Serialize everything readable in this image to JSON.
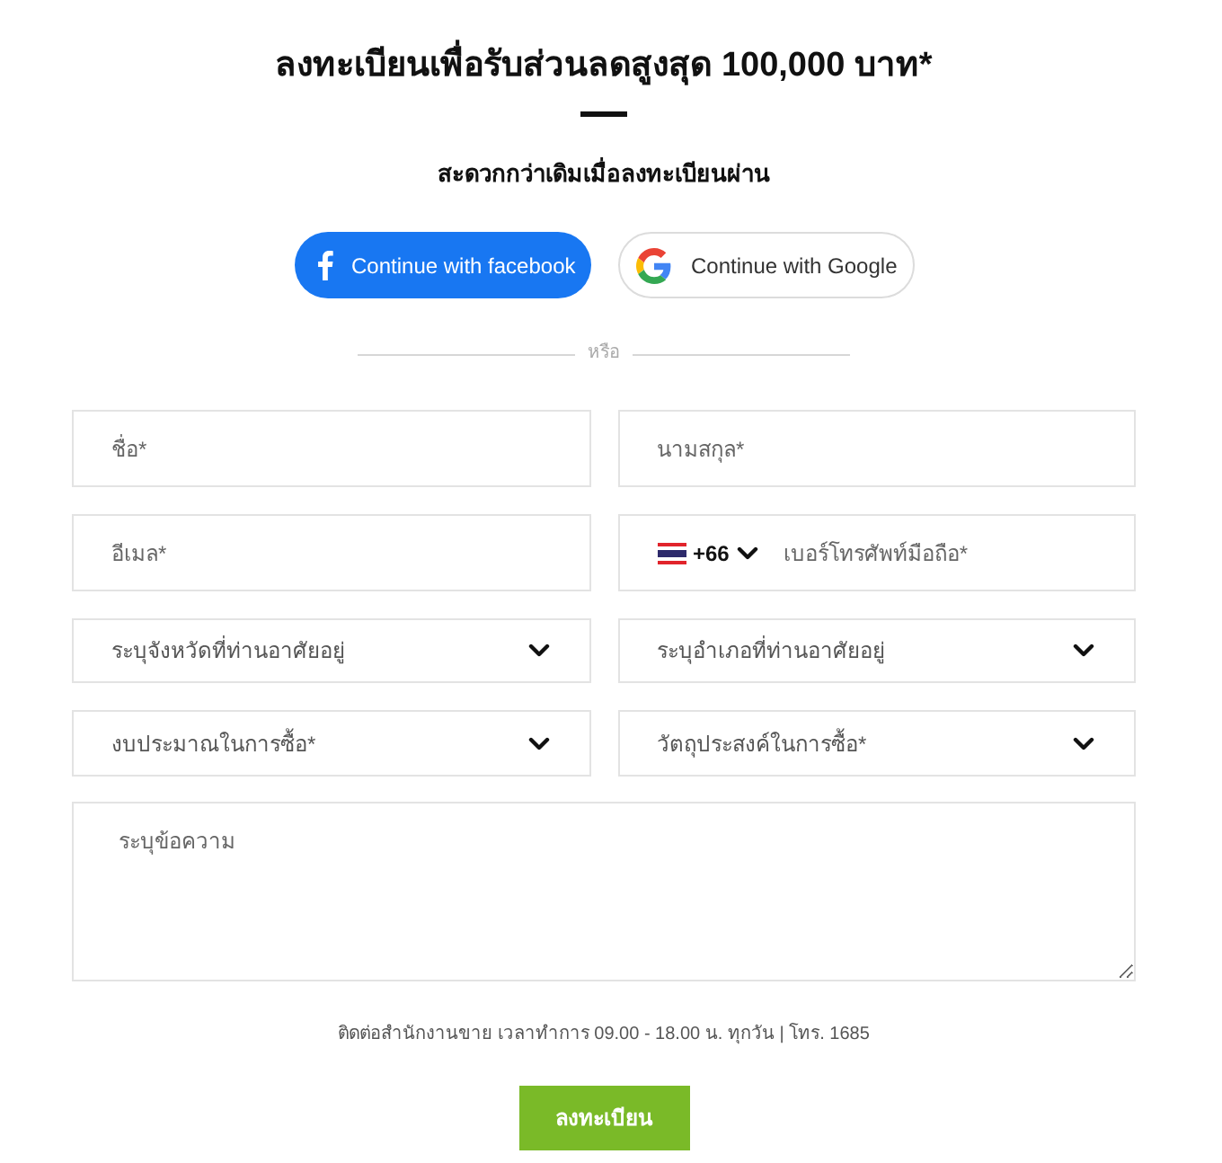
{
  "heading": {
    "title": "ลงทะเบียนเพื่อรับส่วนลดสูงสุด 100,000 บาท*",
    "subtitle": "สะดวกกว่าเดิมเมื่อลงทะเบียนผ่าน"
  },
  "social_buttons": [
    {
      "kind": "facebook",
      "label": "Continue with facebook"
    },
    {
      "kind": "google",
      "label": "Continue with Google"
    }
  ],
  "divider_label": "หรือ",
  "fields": [
    {
      "kind": "text",
      "placeholder": "ชื่อ*"
    },
    {
      "kind": "text",
      "placeholder": "นามสกุล*"
    },
    {
      "kind": "email",
      "placeholder": "อีเมล*"
    },
    {
      "kind": "phone",
      "country_code": "+66",
      "placeholder": "เบอร์โทรศัพท์มือถือ*"
    },
    {
      "kind": "select",
      "label": "ระบุจังหวัดที่ท่านอาศัยอยู่"
    },
    {
      "kind": "select",
      "label": "ระบุอำเภอที่ท่านอาศัยอยู่"
    },
    {
      "kind": "select",
      "label": "งบประมาณในการซื้อ*"
    },
    {
      "kind": "select",
      "label": "วัตถุประสงค์ในการซื้อ*"
    }
  ],
  "message": {
    "placeholder": "ระบุข้อความ"
  },
  "contact_note": "ติดต่อสำนักงานขาย เวลาทำการ 09.00 - 18.00 น. ทุกวัน | โทร. 1685",
  "submit_button": {
    "label": "ลงทะเบียน"
  }
}
